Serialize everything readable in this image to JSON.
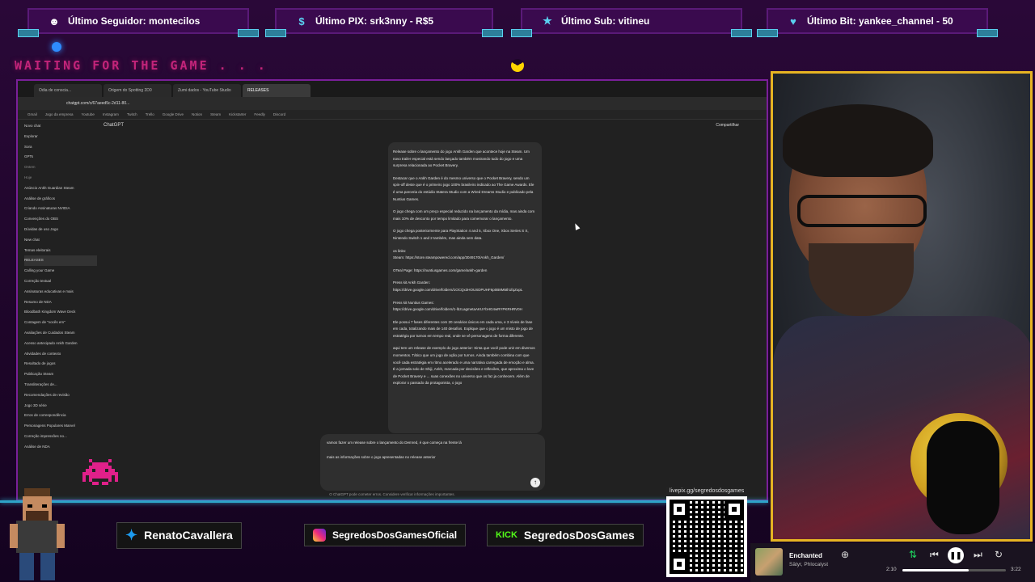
{
  "tickers": [
    {
      "icon": "person-icon",
      "label": "Último Seguidor: montecilos"
    },
    {
      "icon": "pix-icon",
      "label": "Último PIX: srk3nny - R$5"
    },
    {
      "icon": "star-icon",
      "label": "Último Sub: vitineu"
    },
    {
      "icon": "heart-icon",
      "label": "Último Bit: yankee_channel - 50"
    }
  ],
  "waiting_text": "WAITING FOR THE GAME . . .",
  "browser": {
    "tabs": [
      "Odia de conscia...",
      "Origem do Spotting 2D0",
      "Zumi dados - YouTube Studio",
      "RELEASES"
    ],
    "url": "chatgpt.com/c/67aeed5c-2d11-80...",
    "bookmarks": [
      "Gmail",
      "Jogo da empresa",
      "Youtube",
      "Instagram",
      "Twitch",
      "Trello",
      "Google Drive",
      "Notion",
      "Steam",
      "Kickstarter",
      "Feedly",
      "Discord"
    ],
    "chat_title": "ChatGPT",
    "share_label": "Compartilhar",
    "sidebar_items": [
      {
        "label": "Novo chat",
        "type": "item"
      },
      {
        "label": "Explorar",
        "type": "item"
      },
      {
        "label": "Sora",
        "type": "item"
      },
      {
        "label": "GPTs",
        "type": "item"
      },
      {
        "label": "Ontem",
        "type": "sec"
      },
      {
        "label": "Hoje",
        "type": "sec"
      },
      {
        "label": "Anúncio Ankh Guardian Steam",
        "type": "item"
      },
      {
        "label": "Análise de gráficos",
        "type": "item"
      },
      {
        "label": "Criando Assinaturas NVIDIA",
        "type": "item"
      },
      {
        "label": "Convenções do OBS",
        "type": "item"
      },
      {
        "label": "Dúvidas de uso Jogo",
        "type": "item"
      },
      {
        "label": "New chat",
        "type": "item"
      },
      {
        "label": "Temas eleitorais",
        "type": "item"
      },
      {
        "label": "RELEASES",
        "type": "hl"
      },
      {
        "label": "Calling your Game",
        "type": "item"
      },
      {
        "label": "Correção textual",
        "type": "item"
      },
      {
        "label": "Assinaturas educativas e mais",
        "type": "item"
      },
      {
        "label": "Resumo de NDA",
        "type": "item"
      },
      {
        "label": "Bloodbath Kingdom Wave Deck",
        "type": "item"
      },
      {
        "label": "Contagem de \"vocês em\"",
        "type": "item"
      },
      {
        "label": "Avaliações de Cuidados Steam",
        "type": "item"
      },
      {
        "label": "Acesso antecipado Ankh Garden",
        "type": "item"
      },
      {
        "label": "Atividades de contexto",
        "type": "item"
      },
      {
        "label": "Resultado de jogos",
        "type": "item"
      },
      {
        "label": "Publicação Steam",
        "type": "item"
      },
      {
        "label": "Transliterações de...",
        "type": "item"
      },
      {
        "label": "Recomendações de revisão",
        "type": "item"
      },
      {
        "label": "Jogo 3D série",
        "type": "item"
      },
      {
        "label": "Erros de correspondência",
        "type": "item"
      },
      {
        "label": "Personagens Populares Marvel",
        "type": "item"
      },
      {
        "label": "Correção impressões no...",
        "type": "item"
      },
      {
        "label": "Análise de NDA",
        "type": "item"
      }
    ],
    "chat_paragraphs": [
      "Release sobre o lançamento do jogo Ankh Garden que acontece hoje na Steam. Um novo trailer especial está sendo lançado também mostrando tudo do jogo e uma surpresa relacionada ao Pocket Bravery.",
      "Destacar que o Ankh Garden é do mesmo universo que o Pocket Bravery, sendo um spin-off deste que é o primeiro jogo 100% brasileiro indicado ao The Game Awards. Ele é uma parceria do estúdio Statera Studio com a Wired Dreams Studio e publicado pela Nuntius Games.",
      "O jogo chega com um preço especial reduzido na lançamento da mídia, mas ainda com mais 10% de desconto por tempo limitado para comemorar o lançamento.",
      "O jogo chega posteriormente para PlayStation 4 and 5, Xbox One, Xbox Series S X, Nintendo Switch 1 and 2 também, mas ainda sem data.",
      "os links:\nSteam: https://store.steampowered.com/app/3049170/Ankh_Garden/",
      "OTeal Page: https://nuntiusgames.com/game/ankh-garden",
      "Press kit Ankh Garden:\nhttps://drive.google.com/drive/folders/1OCQx3HOUSDPUHF6p0B8M5th1fqZupL",
      "Press kit Nuntius Games:\nhttps://drive.google.com/drive/folders/1-lbzLagmetaAKUYbHG4wRYPKRHRV0H",
      "Ele possui 7 fases diferentes com 20 cenários únicos em cada uma, e 3 níveis de fase em cada, totalizando mais de 140 desafios. Explique que o jogo é um misto de jogo de estratégia por turnos em tempo real, onde se vê personagens de forma diferente.",
      "aqui tem um release de exemplo do jogo anterior: Sinta que você pode unir em diversos momentos. Tático que um jogo de ação por turnos. Ainda também combina com que você cada estratégia em ritmo acelerado e uma narrativa carregada de emoção e alma. É a jornada solo de Shiji, Ankh, marcada por decisões e reflexões, que aproxima o love de Pocket Bravery e ... suas conexões no universo que os faz ja conhecem. Além de explorar o passado da protagonista, o jogo"
    ],
    "composer_line1": "vamos fazer um release sobre o lançamento do Demred, é que começa na frente lá",
    "composer_line2": "mais as informações sobre o jogo apresentadas no release anterior",
    "disclaimer": "O ChatGPT pode cometer erros. Considere verificar informações importantes."
  },
  "socials": {
    "twitter": "RenatoCavallera",
    "instagram": "SegredosDosGamesOficial",
    "kick_logo": "KICK",
    "kick": "SegredosDosGames"
  },
  "qr_label": "livepix.gg/segredosdosgames",
  "player": {
    "song": "Enchanted",
    "artist": "Sätyr, Phlocalyst",
    "elapsed": "2:10",
    "duration": "3:22",
    "progress": 0.64
  }
}
